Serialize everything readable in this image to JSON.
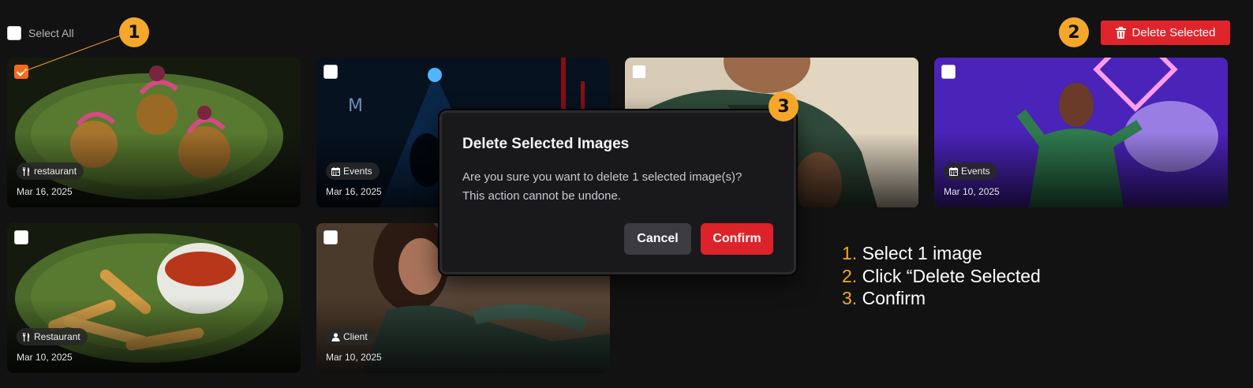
{
  "toolbar": {
    "select_all_label": "Select All",
    "delete_selected_label": "Delete Selected"
  },
  "steps": [
    "1",
    "2",
    "3"
  ],
  "cards": [
    {
      "tag": "restaurant",
      "tag_icon": "utensils-icon",
      "date": "Mar 16, 2025",
      "checked": true
    },
    {
      "tag": "Events",
      "tag_icon": "calendar-icon",
      "date": "Mar 16, 2025",
      "checked": false
    },
    {
      "tag": "",
      "tag_icon": "",
      "date": "",
      "checked": false
    },
    {
      "tag": "Events",
      "tag_icon": "calendar-icon",
      "date": "Mar 10, 2025",
      "checked": false
    },
    {
      "tag": "Restaurant",
      "tag_icon": "utensils-icon",
      "date": "Mar 10, 2025",
      "checked": false
    },
    {
      "tag": "Client",
      "tag_icon": "user-icon",
      "date": "Mar 10, 2025",
      "checked": false
    }
  ],
  "modal": {
    "title": "Delete Selected Images",
    "body_line1": "Are you sure you want to delete 1 selected image(s)?",
    "body_line2": "This action cannot be undone.",
    "cancel_label": "Cancel",
    "confirm_label": "Confirm"
  },
  "instructions": [
    {
      "num": "1.",
      "text": "Select 1 image"
    },
    {
      "num": "2.",
      "text": "Click “Delete Selected"
    },
    {
      "num": "3.",
      "text": "Confirm"
    }
  ],
  "colors": {
    "background": "#121212",
    "accent_orange": "#f4a72a",
    "checkbox_checked": "#f26b1d",
    "danger_red": "#e0242b"
  }
}
